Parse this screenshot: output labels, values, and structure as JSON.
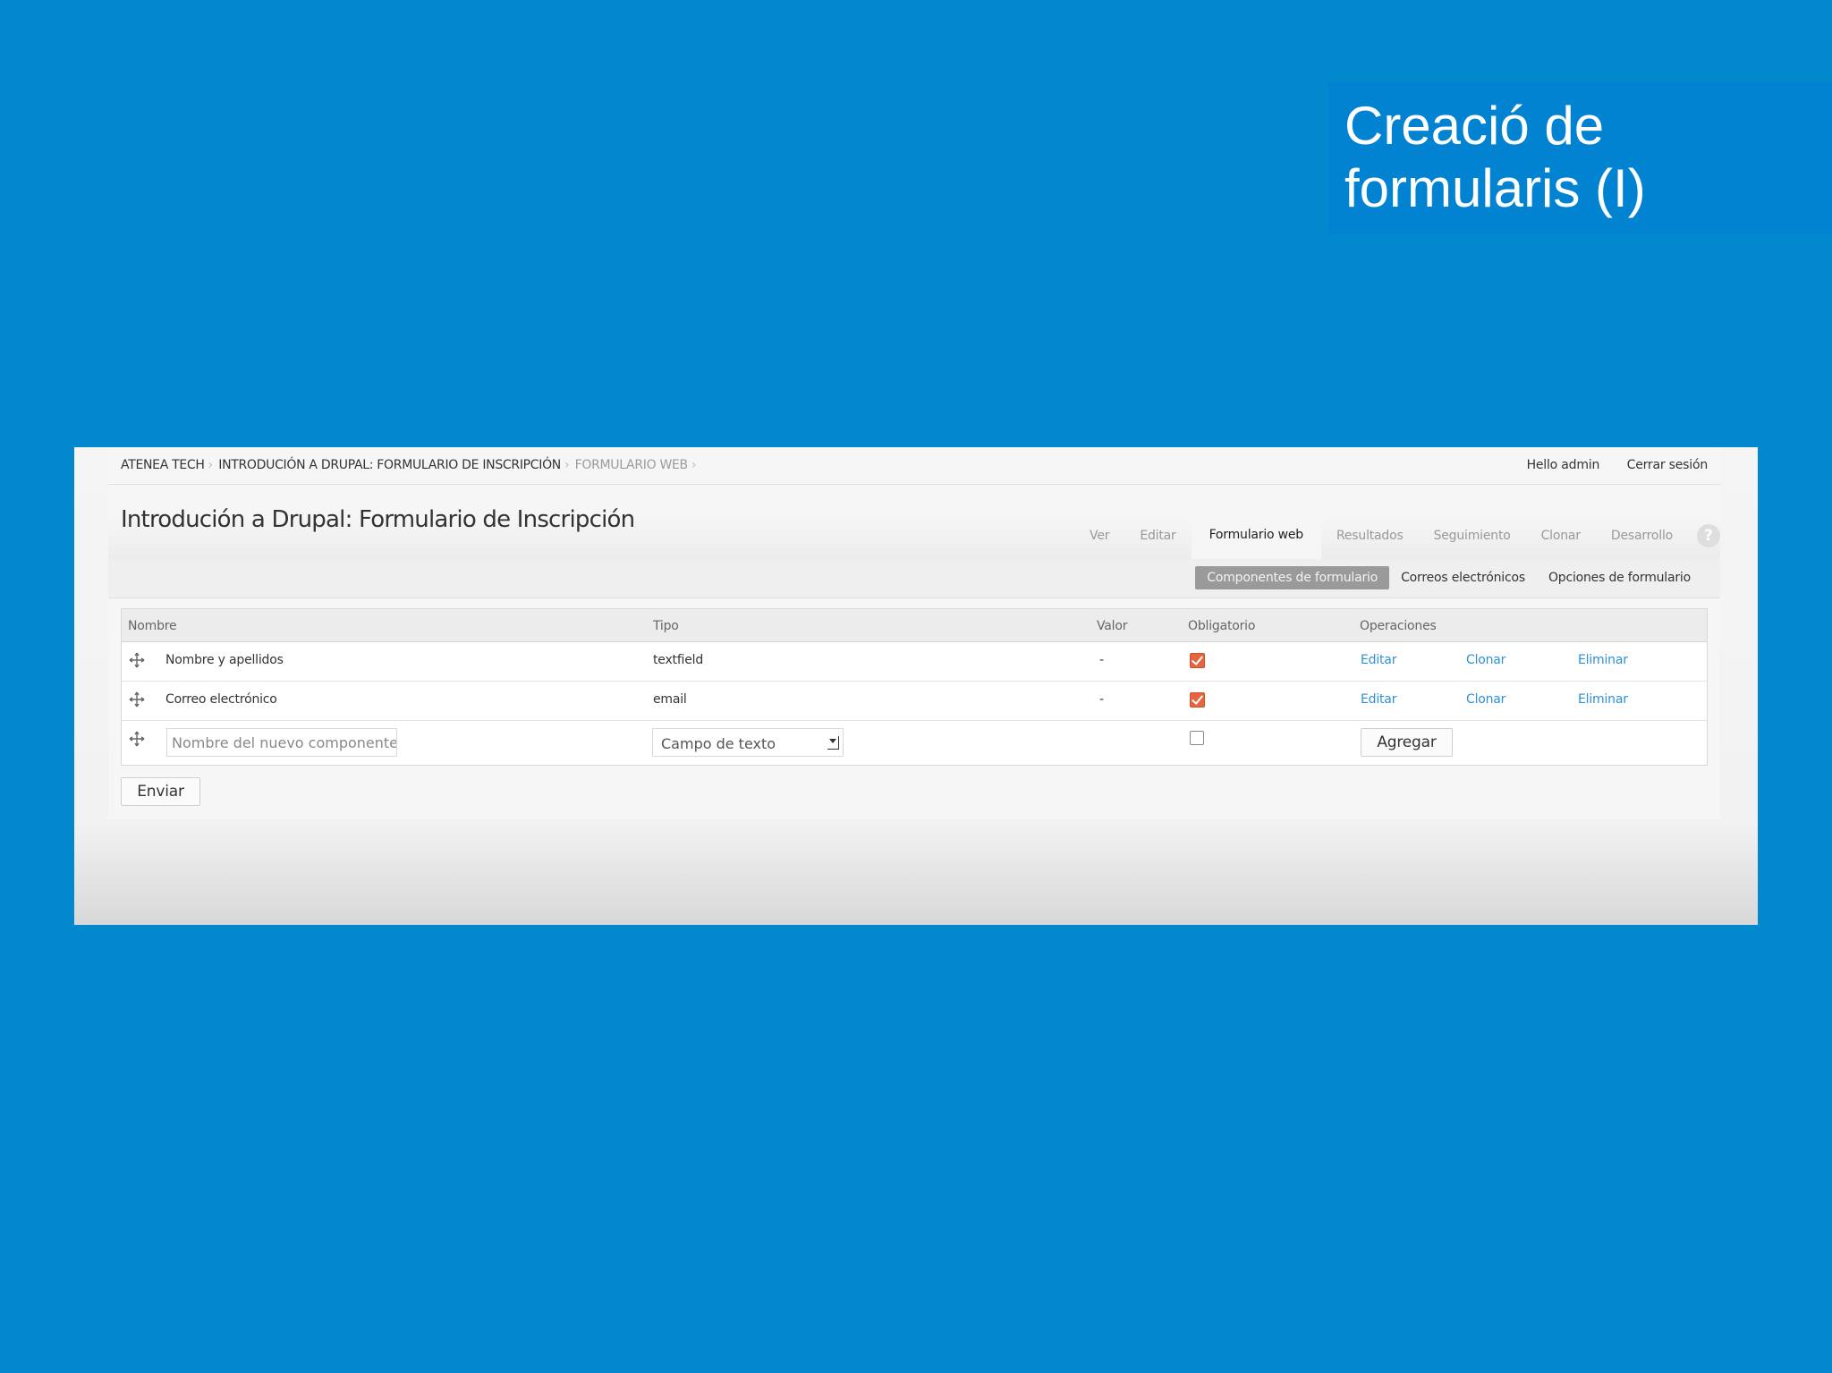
{
  "slide": {
    "title_line1": "Creació de",
    "title_line2": "formularis (I)"
  },
  "breadcrumb": [
    "ATENEA TECH",
    "INTRODUCIÓN A DRUPAL: FORMULARIO DE INSCRIPCIÓN",
    "FORMULARIO WEB"
  ],
  "user": {
    "greeting": "Hello admin",
    "logout": "Cerrar sesión"
  },
  "page_title": "Introdución a Drupal: Formulario de Inscripción",
  "tabs": [
    "Ver",
    "Editar",
    "Formulario web",
    "Resultados",
    "Seguimiento",
    "Clonar",
    "Desarrollo"
  ],
  "active_tab": "Formulario web",
  "help_icon": "?",
  "subtabs": [
    "Componentes de formulario",
    "Correos electrónicos",
    "Opciones de formulario"
  ],
  "table": {
    "headers": [
      "Nombre",
      "Tipo",
      "Valor",
      "Obligatorio",
      "Operaciones"
    ],
    "rows": [
      {
        "name": "Nombre y apellidos",
        "type": "textfield",
        "value": "-",
        "required": true,
        "ops": [
          "Editar",
          "Clonar",
          "Eliminar"
        ]
      },
      {
        "name": "Correo electrónico",
        "type": "email",
        "value": "-",
        "required": true,
        "ops": [
          "Editar",
          "Clonar",
          "Eliminar"
        ]
      }
    ],
    "new_row": {
      "name_placeholder": "Nombre del nuevo componente",
      "type_selected": "Campo de texto",
      "required": false,
      "add_label": "Agregar"
    }
  },
  "submit_label": "Enviar",
  "colors": {
    "slide_bg": "#0288cd",
    "link": "#2f90d4",
    "checkbox": "#e3663f",
    "active_subtab": "#9a9a9a"
  }
}
